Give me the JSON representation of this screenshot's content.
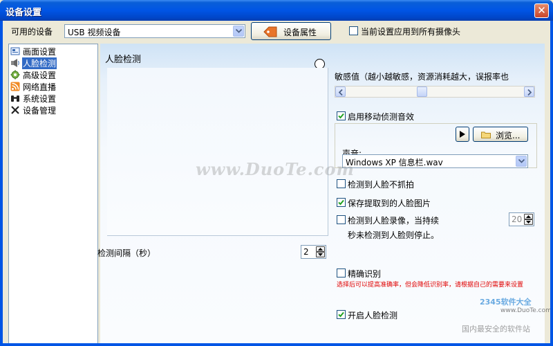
{
  "window": {
    "title": "设备设置",
    "close_glyph": "✕"
  },
  "top": {
    "device_label": "可用的设备",
    "device_value": "USB 视频设备",
    "props_button": "设备属性",
    "apply_all": {
      "label": "当前设置应用到所有摄像头",
      "checked": false
    }
  },
  "sidebar": {
    "items": [
      {
        "label": "画面设置",
        "icon": "picture-icon",
        "selected": false
      },
      {
        "label": "人脸检测",
        "icon": "face-icon",
        "selected": true
      },
      {
        "label": "高级设置",
        "icon": "gear-icon",
        "selected": false
      },
      {
        "label": "网络直播",
        "icon": "rss-icon",
        "selected": false
      },
      {
        "label": "系统设置",
        "icon": "binoculars-icon",
        "selected": false
      },
      {
        "label": "设备管理",
        "icon": "tools-icon",
        "selected": false
      }
    ]
  },
  "main": {
    "section_title": "人脸检测",
    "interval_label": "检测间隔（秒）",
    "interval_value": "2",
    "sensitivity_label": "敏感值（越小越敏感，资源消耗越大，误报率也",
    "motion_sound": {
      "label": "启用移动侦测音效",
      "checked": true
    },
    "sound_label": "声音:",
    "browse_button": "浏览...",
    "sound_file": "Windows XP 信息栏.wav",
    "no_capture": {
      "label": "检测到人脸不抓拍",
      "checked": false
    },
    "save_face": {
      "label": "保存提取到的人脸图片",
      "checked": true
    },
    "record": {
      "label_line1": "检测到人脸录像，当持续",
      "label_line2": "秒未检测到人脸则停止。",
      "checked": false,
      "seconds": "20"
    },
    "precise": {
      "label": "精确识别",
      "checked": false
    },
    "precise_note": "选择后可以提高准确率，但会降低识别率，请根据自己的需要来设置",
    "enable_face": {
      "label": "开启人脸检测",
      "checked": true
    }
  },
  "watermarks": {
    "center": "www.DuoTe.com",
    "corner_brand": "2345软件大全",
    "corner_url": "www.DuoTe.com",
    "corner_slogan": "国内最安全的软件站"
  }
}
